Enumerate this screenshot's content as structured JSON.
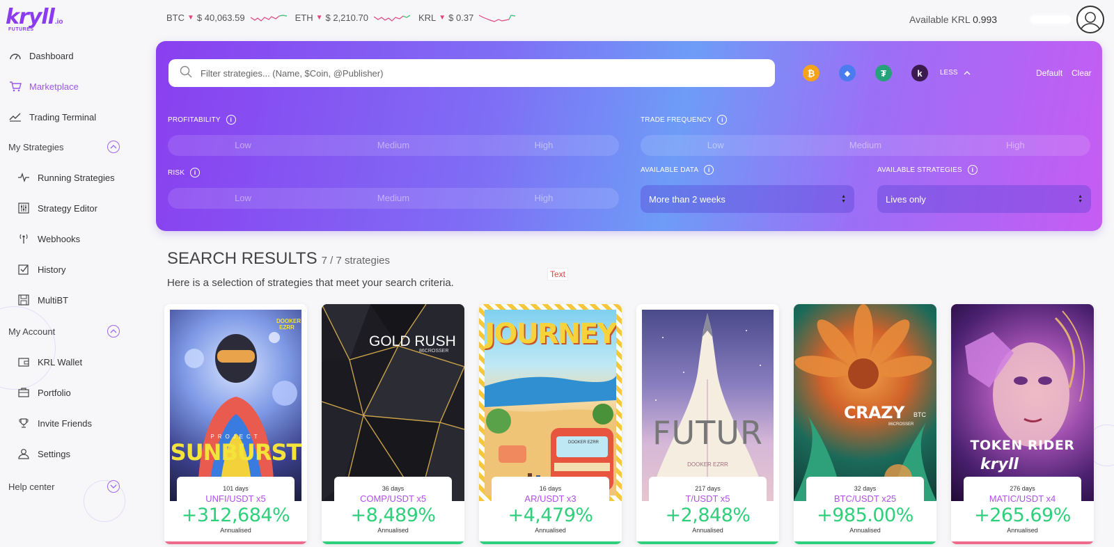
{
  "brand": {
    "name": "kryll",
    "suffix": ".io",
    "tagline": "FUTURES",
    "accent": "#8b3cf0"
  },
  "sidebar": {
    "items": [
      {
        "label": "Dashboard",
        "icon": "gauge-icon"
      },
      {
        "label": "Marketplace",
        "icon": "cart-icon",
        "active": true
      },
      {
        "label": "Trading Terminal",
        "icon": "trend-line-icon"
      }
    ],
    "my_strategies": {
      "label": "My Strategies",
      "items": [
        {
          "label": "Running Strategies",
          "icon": "pulse-icon"
        },
        {
          "label": "Strategy Editor",
          "icon": "sliders-icon"
        },
        {
          "label": "Webhooks",
          "icon": "antenna-icon"
        },
        {
          "label": "History",
          "icon": "checkbox-icon"
        },
        {
          "label": "MultiBT",
          "icon": "floppy-icon"
        }
      ]
    },
    "my_account": {
      "label": "My Account",
      "items": [
        {
          "label": "KRL Wallet",
          "icon": "wallet-icon"
        },
        {
          "label": "Portfolio",
          "icon": "briefcase-icon"
        },
        {
          "label": "Invite Friends",
          "icon": "trophy-icon"
        },
        {
          "label": "Settings",
          "icon": "user-icon"
        }
      ]
    },
    "help_center": {
      "label": "Help center"
    }
  },
  "ticker": [
    {
      "symbol": "BTC",
      "price": "$ 40,063.59"
    },
    {
      "symbol": "ETH",
      "price": "$ 2,210.70"
    },
    {
      "symbol": "KRL",
      "price": "$ 0.37"
    }
  ],
  "account": {
    "available_label": "Available KRL",
    "available_value": "0.993"
  },
  "filters": {
    "search_placeholder": "Filter strategies... (Name, $Coin, @Publisher)",
    "coins": [
      {
        "name": "bitcoin-icon",
        "color": "#f7a21b",
        "glyph": "₿"
      },
      {
        "name": "ethereum-icon",
        "color": "#4a7cf0",
        "glyph": "◆"
      },
      {
        "name": "tether-icon",
        "color": "#26a17b",
        "glyph": "₮"
      },
      {
        "name": "kryll-icon",
        "color": "#3b1a4e",
        "glyph": "k"
      }
    ],
    "less_label": "LESS",
    "default_label": "Default",
    "clear_label": "Clear",
    "profitability": {
      "label": "PROFITABILITY",
      "options": [
        "Low",
        "Medium",
        "High"
      ]
    },
    "trade_frequency": {
      "label": "TRADE FREQUENCY",
      "options": [
        "Low",
        "Medium",
        "High"
      ]
    },
    "risk": {
      "label": "RISK",
      "options": [
        "Low",
        "Medium",
        "High"
      ]
    },
    "available_data": {
      "label": "AVAILABLE DATA",
      "value": "More than 2 weeks"
    },
    "available_strategies": {
      "label": "AVAILABLE STRATEGIES",
      "value": "Lives only"
    }
  },
  "results": {
    "title": "SEARCH RESULTS",
    "count": "7 / 7 strategies",
    "subtitle": "Here is a selection of strategies that meet your search criteria.",
    "text_button": "Text",
    "cards": [
      {
        "days": "101 days",
        "pair": "UNFI/USDT x5",
        "pct": "+312,684%",
        "annualised": "Annualised",
        "art_title": "SUNBURST",
        "art_top": "PROJECT",
        "art_credit": "DOOKER EZRR",
        "bar": "#f06a8c"
      },
      {
        "days": "36 days",
        "pair": "COMP/USDT x5",
        "pct": "+8,489%",
        "annualised": "Annualised",
        "art_title": "GOLD RUSH",
        "art_top": "",
        "art_credit": "86CROSSER",
        "bar": "#2fcf7b"
      },
      {
        "days": "16 days",
        "pair": "AR/USDT x3",
        "pct": "+4,479%",
        "annualised": "Annualised",
        "art_title": "JOURNEY",
        "art_top": "",
        "art_credit": "DOOKER EZRR",
        "bar": "#2fcf7b"
      },
      {
        "days": "217 days",
        "pair": "T/USDT x5",
        "pct": "+2,848%",
        "annualised": "Annualised",
        "art_title": "FUTUR",
        "art_top": "",
        "art_credit": "DOOKER EZRR",
        "bar": "#2fcf7b"
      },
      {
        "days": "32 days",
        "pair": "BTC/USDT x25",
        "pct": "+985.00%",
        "annualised": "Annualised",
        "art_title": "CRAZY",
        "art_top": "BTC",
        "art_credit": "86CROSSER",
        "bar": "#2fcf7b"
      },
      {
        "days": "276 days",
        "pair": "MATIC/USDT x4",
        "pct": "+265.69%",
        "annualised": "Annualised",
        "art_title": "TOKEN RIDER",
        "art_top": "",
        "art_credit": "kryll",
        "bar": "#f06a8c"
      }
    ]
  }
}
